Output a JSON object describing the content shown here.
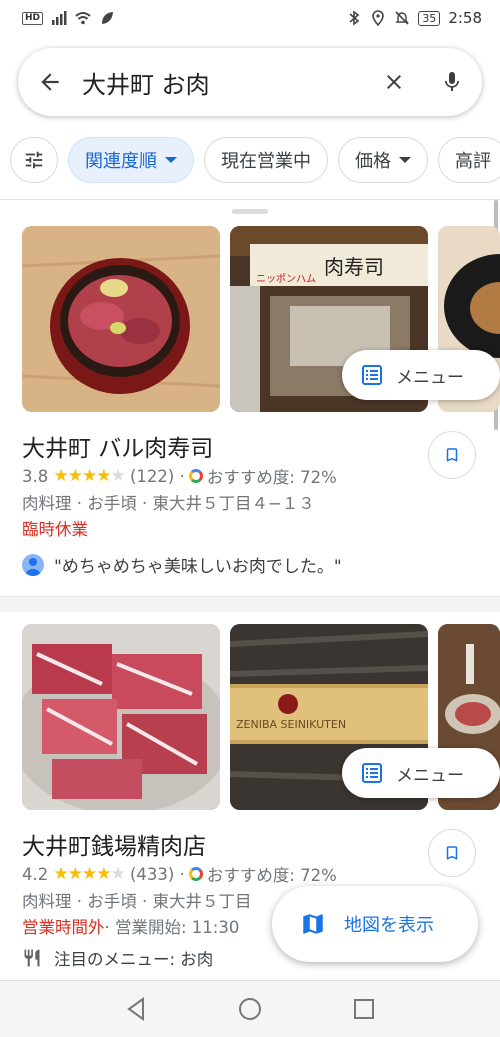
{
  "status_bar": {
    "hd": "HD",
    "battery": "35",
    "time": "2:58"
  },
  "search": {
    "query": "大井町 お肉"
  },
  "chips": [
    {
      "label": "関連度順",
      "active": true,
      "dropdown": true
    },
    {
      "label": "現在営業中",
      "active": false,
      "dropdown": false
    },
    {
      "label": "価格",
      "active": false,
      "dropdown": true
    },
    {
      "label": "高評",
      "active": false,
      "dropdown": false
    }
  ],
  "results": [
    {
      "name": "大井町 バル肉寿司",
      "rating": "3.8",
      "stars": 4,
      "reviews": "(122)",
      "recommend": "おすすめ度: 72%",
      "details": "肉料理 · お手頃 · 東大井５丁目４−１３",
      "status": "臨時休業",
      "review_snippet": "\"めちゃめちゃ美味しいお肉でした。\"",
      "menu_label": "メニュー",
      "sign_text": "肉寿司",
      "sign_sub": "ニッポンハム"
    },
    {
      "name": "大井町銭場精肉店",
      "rating": "4.2",
      "stars": 4,
      "reviews": "(433)",
      "recommend": "おすすめ度: 72%",
      "details": "肉料理 · お手頃 · 東大井５丁目",
      "status": "営業時間外",
      "status_extra": " · 営業開始: 11:30",
      "featured_menu": "注目のメニュー: お肉",
      "menu_label": "メニュー",
      "sign_text": "ZENIBA SEINIKUTEN"
    }
  ],
  "map_button": {
    "label": "地図を表示"
  },
  "colors": {
    "accent": "#1a73e8",
    "star": "#fbbc04",
    "closed": "#d93025"
  }
}
